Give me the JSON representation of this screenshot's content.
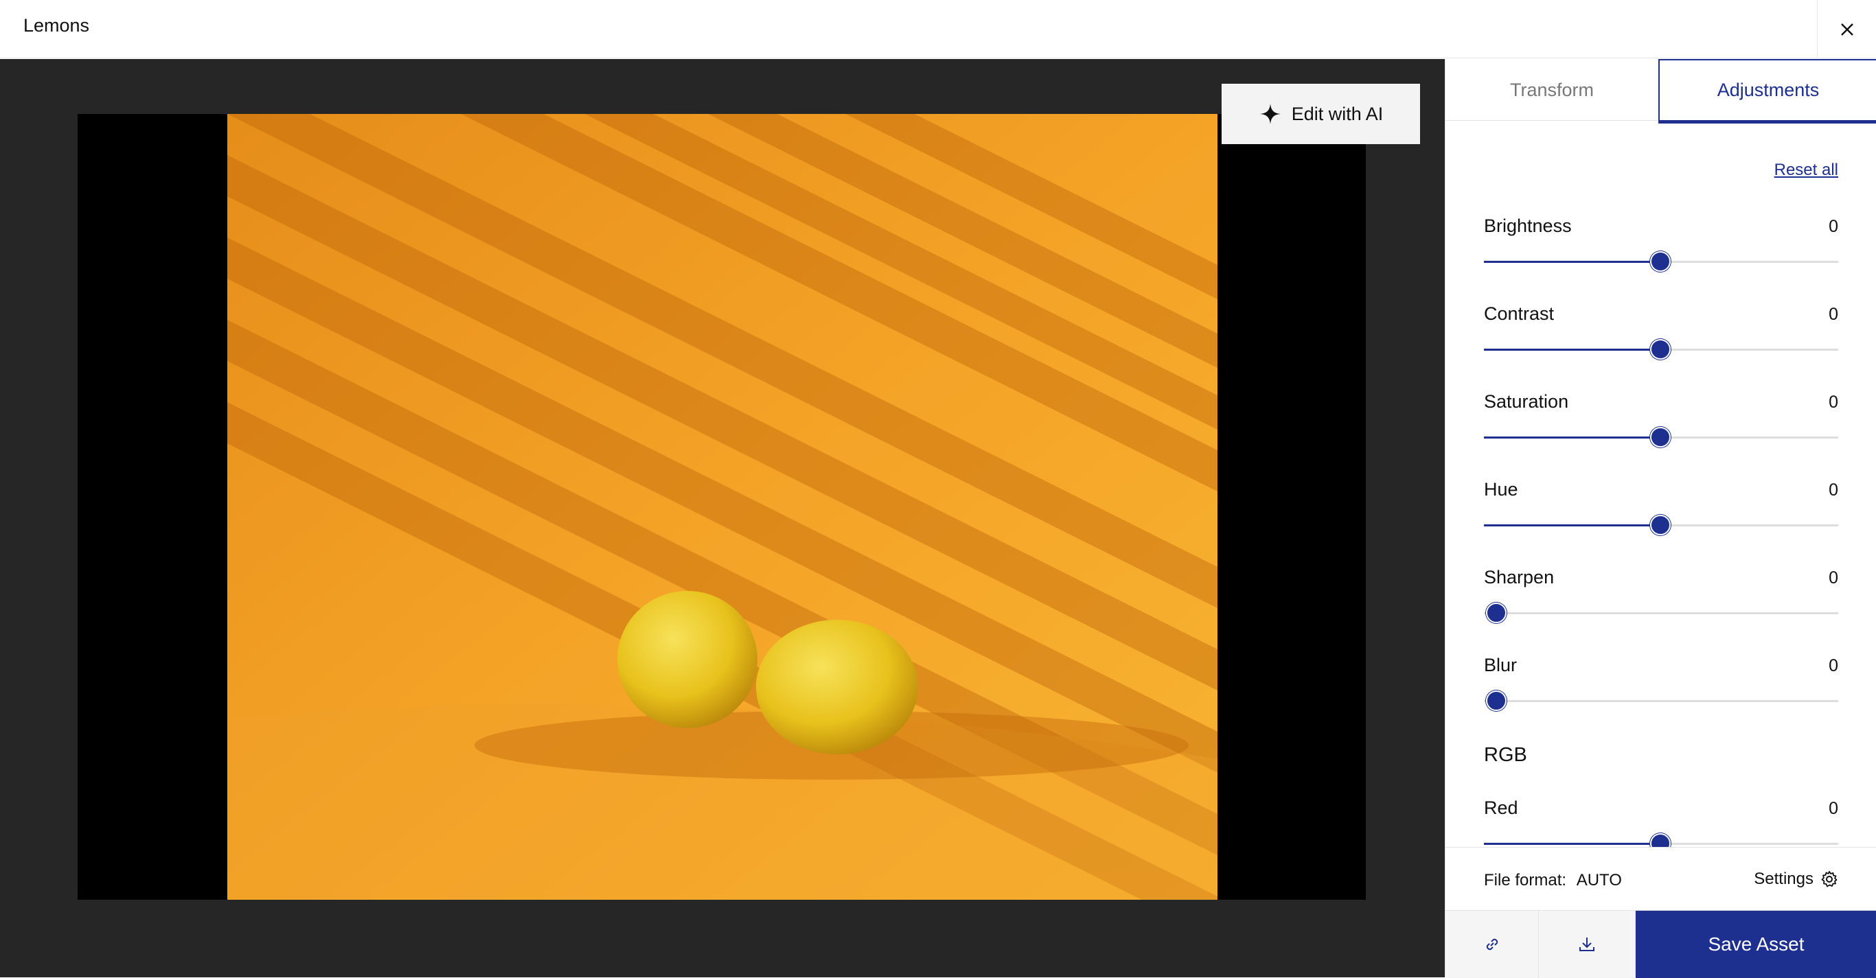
{
  "header": {
    "title": "Lemons"
  },
  "toolbar": {
    "ai_button_label": "Edit with AI"
  },
  "tabs": [
    {
      "label": "Transform",
      "active": false
    },
    {
      "label": "Adjustments",
      "active": true
    }
  ],
  "adjustments": {
    "reset_label": "Reset all",
    "sliders": [
      {
        "label": "Brightness",
        "value": "0",
        "level": 0.5
      },
      {
        "label": "Contrast",
        "value": "0",
        "level": 0.5
      },
      {
        "label": "Saturation",
        "value": "0",
        "level": 0.5
      },
      {
        "label": "Hue",
        "value": "0",
        "level": 0.5
      },
      {
        "label": "Sharpen",
        "value": "0",
        "level": 0.0
      },
      {
        "label": "Blur",
        "value": "0",
        "level": 0.0
      }
    ],
    "rgb_heading": "RGB",
    "red": {
      "label": "Red",
      "value": "0",
      "level": 0.5
    }
  },
  "footer": {
    "file_format_label": "File format:",
    "file_format_value": "AUTO",
    "settings_label": "Settings",
    "save_label": "Save Asset"
  },
  "colors": {
    "accent": "#1d2f8f",
    "canvas": "#262626"
  },
  "icons": [
    "close-icon",
    "sparkle-icon",
    "gear-icon",
    "link-icon",
    "download-icon"
  ]
}
